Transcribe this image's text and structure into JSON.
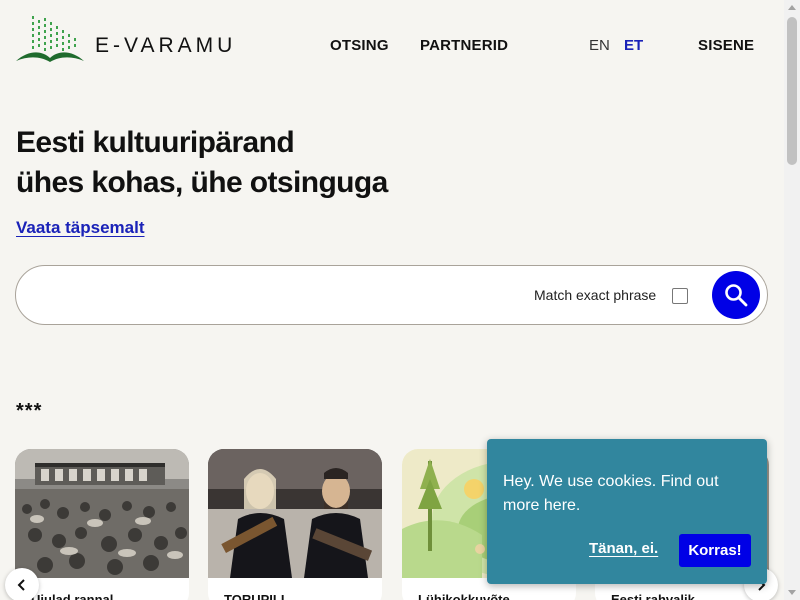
{
  "header": {
    "logo_text": "E-VARAMU",
    "nav": [
      {
        "label": "OTSING"
      },
      {
        "label": "PARTNERID"
      }
    ],
    "languages": [
      {
        "label": "EN",
        "active": false
      },
      {
        "label": "ET",
        "active": true
      }
    ],
    "login_label": "SISENE"
  },
  "hero": {
    "title_line1": "Eesti kultuuripärand",
    "title_line2": "ühes kohas, ühe otsinguga",
    "more_link": "Vaata täpsemalt"
  },
  "search": {
    "placeholder": "",
    "value": "",
    "exact_label": "Match exact phrase",
    "exact_checked": false,
    "button_icon": "search-icon"
  },
  "featured": {
    "section_title": "***",
    "cards": [
      {
        "title": "Ujulad rannal…",
        "image": "beach-crowd-photo"
      },
      {
        "title": "TORUPILL…",
        "image": "musicians-photo"
      },
      {
        "title": "Lühikokkuvõte…",
        "image": "illustration-landscape"
      },
      {
        "title": "Eesti rahvalik…",
        "image": "archive-photo"
      }
    ],
    "prev_icon": "chevron-left-icon",
    "next_icon": "chevron-right-icon"
  },
  "cookie": {
    "text": "Hey. We use cookies. Find out more here.",
    "deny_label": "Tänan, ei.",
    "accept_label": "Korras!"
  },
  "colors": {
    "background": "#f6f5f1",
    "accent_blue": "#0000e6",
    "link_blue": "#1a22b8",
    "cookie_bg": "#31869e",
    "logo_green": "#2e8b3a"
  }
}
